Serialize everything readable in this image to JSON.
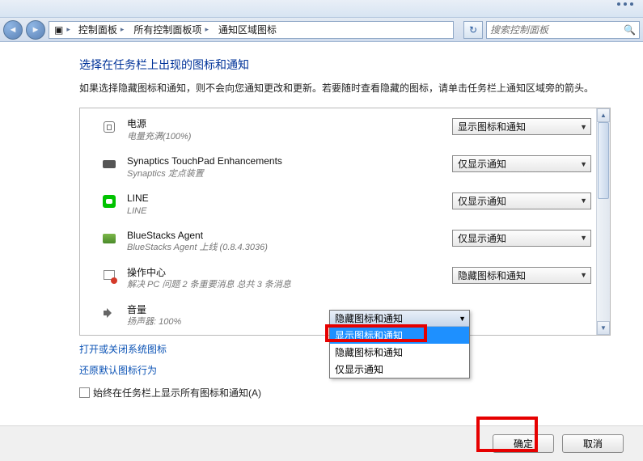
{
  "breadcrumb": {
    "p0": "控制面板",
    "p1": "所有控制面板项",
    "p2": "通知区域图标"
  },
  "search": {
    "placeholder": "搜索控制面板"
  },
  "page": {
    "title": "选择在任务栏上出现的图标和通知",
    "desc": "如果选择隐藏图标和通知，则不会向您通知更改和更新。若要随时查看隐藏的图标，请单击任务栏上通知区域旁的箭头。"
  },
  "opts": {
    "show": "显示图标和通知",
    "notify": "仅显示通知",
    "hide": "隐藏图标和通知"
  },
  "rows": [
    {
      "name": "电源",
      "sub": "电量充满(100%)",
      "value": "显示图标和通知"
    },
    {
      "name": "Synaptics TouchPad Enhancements",
      "sub": "Synaptics 定点装置",
      "value": "仅显示通知"
    },
    {
      "name": "LINE",
      "sub": "LINE",
      "value": "仅显示通知"
    },
    {
      "name": "BlueStacks Agent",
      "sub": "BlueStacks Agent 上线 (0.8.4.3036)",
      "value": "仅显示通知"
    },
    {
      "name": "操作中心",
      "sub": "解决 PC 问题  2 条重要消息  总共 3 条消息",
      "value": "隐藏图标和通知"
    },
    {
      "name": "音量",
      "sub": "扬声器: 100%",
      "value": "隐藏图标和通知"
    }
  ],
  "links": {
    "sysicons": "打开或关闭系统图标",
    "restore": "还原默认图标行为"
  },
  "checkbox": {
    "label": "始终在任务栏上显示所有图标和通知(A)"
  },
  "buttons": {
    "ok": "确定",
    "cancel": "取消"
  }
}
